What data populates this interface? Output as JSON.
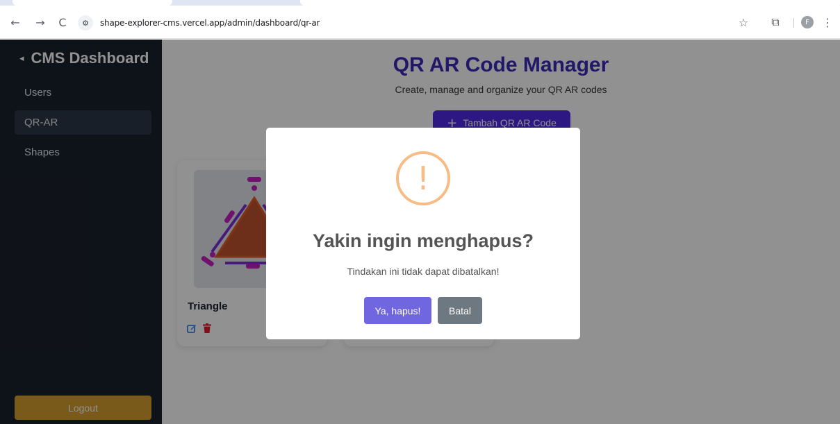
{
  "browser": {
    "back_glyph": "←",
    "forward_glyph": "→",
    "reload_glyph": "C",
    "site_info_glyph": "⚙",
    "url": "shape-explorer-cms.vercel.app/admin/dashboard/qr-ar",
    "bookmark_glyph": "☆",
    "extensions_glyph": "⧉",
    "profile_initial": "F",
    "menu_glyph": "⋮"
  },
  "sidebar": {
    "collapse_glyph": "◂",
    "title": "CMS Dashboard",
    "items": [
      {
        "label": "Users",
        "active": false
      },
      {
        "label": "QR-AR",
        "active": true
      },
      {
        "label": "Shapes",
        "active": false
      }
    ],
    "logout_label": "Logout"
  },
  "main": {
    "title": "QR AR Code Manager",
    "subtitle": "Create, manage and organize your QR AR codes",
    "add_plus": "+",
    "add_label": "Tambah QR AR Code",
    "cards": [
      {
        "title": "Triangle",
        "image_icon": "triangle-illustration",
        "edit_icon": "edit-icon",
        "delete_icon": "trash-icon"
      }
    ]
  },
  "modal": {
    "icon_glyph": "!",
    "title": "Yakin ingin menghapus?",
    "text": "Tindakan ini tidak dapat dibatalkan!",
    "confirm_label": "Ya, hapus!",
    "cancel_label": "Batal"
  },
  "colors": {
    "sidebar_bg": "#1a202c",
    "title_accent": "#3c2ab8",
    "primary_button": "#4f2be6",
    "logout": "#d69e2e",
    "warning": "#f8bb86",
    "confirm": "#7066e0",
    "cancel": "#6e7881"
  }
}
